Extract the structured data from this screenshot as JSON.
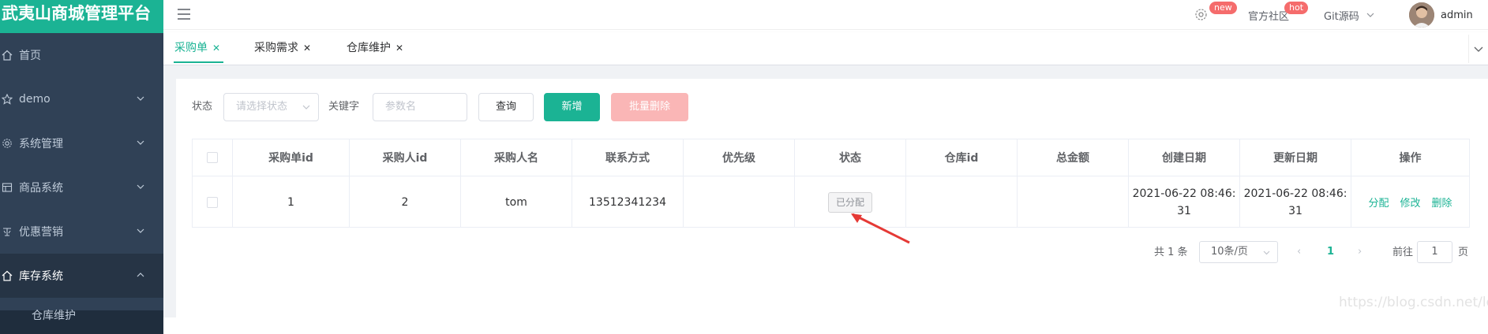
{
  "app": {
    "title": "武夷山商城管理平台"
  },
  "sidebar": {
    "items": [
      {
        "label": "首页",
        "icon": "home-icon",
        "has_arrow": false
      },
      {
        "label": "demo",
        "icon": "star-icon",
        "has_arrow": true
      },
      {
        "label": "系统管理",
        "icon": "gear-icon",
        "has_arrow": true
      },
      {
        "label": "商品系统",
        "icon": "grid-icon",
        "has_arrow": true
      },
      {
        "label": "优惠营销",
        "icon": "tools-icon",
        "has_arrow": true
      },
      {
        "label": "库存系统",
        "icon": "home-icon",
        "has_arrow": true,
        "expanded": true
      }
    ],
    "submenu": {
      "label": "仓库维护"
    }
  },
  "navbar": {
    "badge_new": "new",
    "community": "官方社区",
    "badge_hot": "hot",
    "git": "Git源码",
    "username": "admin"
  },
  "tags": [
    {
      "label": "采购单",
      "active": true
    },
    {
      "label": "采购需求",
      "active": false
    },
    {
      "label": "仓库维护",
      "active": false
    }
  ],
  "filter": {
    "status_label": "状态",
    "status_placeholder": "请选择状态",
    "keyword_label": "关键字",
    "keyword_placeholder": "参数名",
    "query_button": "查询",
    "add_button": "新增",
    "batch_delete_button": "批量删除"
  },
  "table": {
    "columns": [
      "采购单id",
      "采购人id",
      "采购人名",
      "联系方式",
      "优先级",
      "状态",
      "仓库id",
      "总金额",
      "创建日期",
      "更新日期",
      "操作"
    ],
    "rows": [
      {
        "id": "1",
        "buyer_id": "2",
        "buyer_name": "tom",
        "phone": "13512341234",
        "priority": "",
        "status": "已分配",
        "warehouse_id": "",
        "total": "",
        "created_line1": "2021-06-22 08:46:",
        "created_line2": "31",
        "updated_line1": "2021-06-22 08:46:",
        "updated_line2": "31",
        "ops": [
          "分配",
          "修改",
          "删除"
        ]
      }
    ]
  },
  "pagination": {
    "total_text": "共 1 条",
    "page_size": "10条/页",
    "current_page": "1",
    "goto_label": "前往",
    "goto_value": "1",
    "page_suffix": "页"
  },
  "watermark": "https://blog.csdn.net/lovoo",
  "colors": {
    "primary": "#1bb394",
    "sidebar_bg": "#304156",
    "danger_light": "#fab6b6"
  }
}
